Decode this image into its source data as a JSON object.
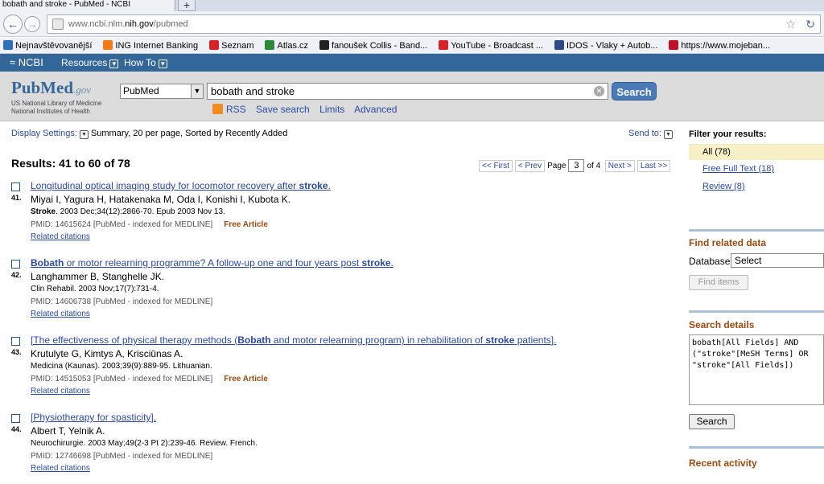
{
  "browser": {
    "tab_title": "bobath and stroke - PubMed - NCBI",
    "new_tab": "+",
    "url_prefix": "www.ncbi.nlm.",
    "url_host": "nih.gov",
    "url_path": "/pubmed",
    "bookmarks": [
      {
        "label": "Nejnavštěvovanější",
        "color": "#2f6fb5"
      },
      {
        "label": "ING Internet Banking",
        "color": "#f07a1a"
      },
      {
        "label": "Seznam",
        "color": "#d8222a"
      },
      {
        "label": "Atlas.cz",
        "color": "#2a8a3a"
      },
      {
        "label": "fanoušek Collis - Band...",
        "color": "#222222"
      },
      {
        "label": "YouTube - Broadcast ...",
        "color": "#d8222a"
      },
      {
        "label": "IDOS - Vlaky + Autob...",
        "color": "#2a4a8a"
      },
      {
        "label": "https://www.mojeban...",
        "color": "#c0102a"
      }
    ]
  },
  "ncbi": {
    "logo": "NCBI",
    "resources": "Resources",
    "howto": "How To"
  },
  "pubmed": {
    "logo_main": "PubMed",
    "logo_gov": ".gov",
    "sub1": "US National Library of Medicine",
    "sub2": "National Institutes of Health",
    "db_value": "PubMed",
    "query": "bobath and stroke",
    "search_label": "Search",
    "links": {
      "rss": "RSS",
      "save": "Save search",
      "limits": "Limits",
      "advanced": "Advanced"
    }
  },
  "main": {
    "display_settings": "Display Settings:",
    "display_summary": "Summary, 20 per page, Sorted by Recently Added",
    "send_to": "Send to:",
    "results_title": "Results: 41 to 60 of 78",
    "pager": {
      "first": "<< First",
      "prev": "< Prev",
      "page_label": "Page",
      "page": "3",
      "of": "of 4",
      "next": "Next >",
      "last": "Last >>"
    },
    "results": [
      {
        "num": "41.",
        "title_parts": [
          {
            "t": "Longitudinal optical imaging study for locomotor recovery after ",
            "b": false
          },
          {
            "t": "stroke",
            "b": true
          },
          {
            "t": ".",
            "b": false
          }
        ],
        "authors": "Miyai I, Yagura H, Hatakenaka M, Oda I, Konishi I, Kubota K.",
        "journal": "Stroke",
        "source": ". 2003 Dec;34(12):2866-70. Epub 2003 Nov 13.",
        "pmid": "PMID: 14615624 [PubMed - indexed for MEDLINE]",
        "free": "Free Article",
        "related": "Related citations"
      },
      {
        "num": "42.",
        "title_parts": [
          {
            "t": "Bobath",
            "b": true
          },
          {
            "t": " or motor relearning programme? A follow-up one and four years post ",
            "b": false
          },
          {
            "t": "stroke",
            "b": true
          },
          {
            "t": ".",
            "b": false
          }
        ],
        "authors": "Langhammer B, Stanghelle JK.",
        "journal": "",
        "source": "Clin Rehabil. 2003 Nov;17(7):731-4.",
        "pmid": "PMID: 14606738 [PubMed - indexed for MEDLINE]",
        "free": "",
        "related": "Related citations"
      },
      {
        "num": "43.",
        "title_parts": [
          {
            "t": "[The effectiveness of physical therapy methods (",
            "b": false
          },
          {
            "t": "Bobath",
            "b": true
          },
          {
            "t": " and motor relearning program) in rehabilitation of ",
            "b": false
          },
          {
            "t": "stroke",
            "b": true
          },
          {
            "t": " patients].",
            "b": false
          }
        ],
        "authors": "Krutulyte G, Kimtys A, Krisciūnas A.",
        "journal": "",
        "source": "Medicina (Kaunas). 2003;39(9):889-95. Lithuanian.",
        "pmid": "PMID: 14515053 [PubMed - indexed for MEDLINE]",
        "free": "Free Article",
        "related": "Related citations"
      },
      {
        "num": "44.",
        "title_parts": [
          {
            "t": "[Physiotherapy for spasticity].",
            "b": false
          }
        ],
        "authors": "Albert T, Yelnik A.",
        "journal": "",
        "source": "Neurochirurgie. 2003 May;49(2-3 Pt 2):239-46. Review. French.",
        "pmid": "PMID: 12746698 [PubMed - indexed for MEDLINE]",
        "free": "",
        "related": "Related citations"
      }
    ]
  },
  "sidebar": {
    "filter_title": "Filter your results:",
    "filters": [
      "All (78)",
      "Free Full Text (18)",
      "Review (8)"
    ],
    "find_related": "Find related data",
    "database_label": "Database:",
    "database_value": "Select",
    "find_items": "Find items",
    "search_details": "Search details",
    "details_text": "bobath[All Fields] AND\n(\"stroke\"[MeSH Terms] OR\n\"stroke\"[All Fields])",
    "search_button": "Search",
    "recent_activity": "Recent activity"
  }
}
